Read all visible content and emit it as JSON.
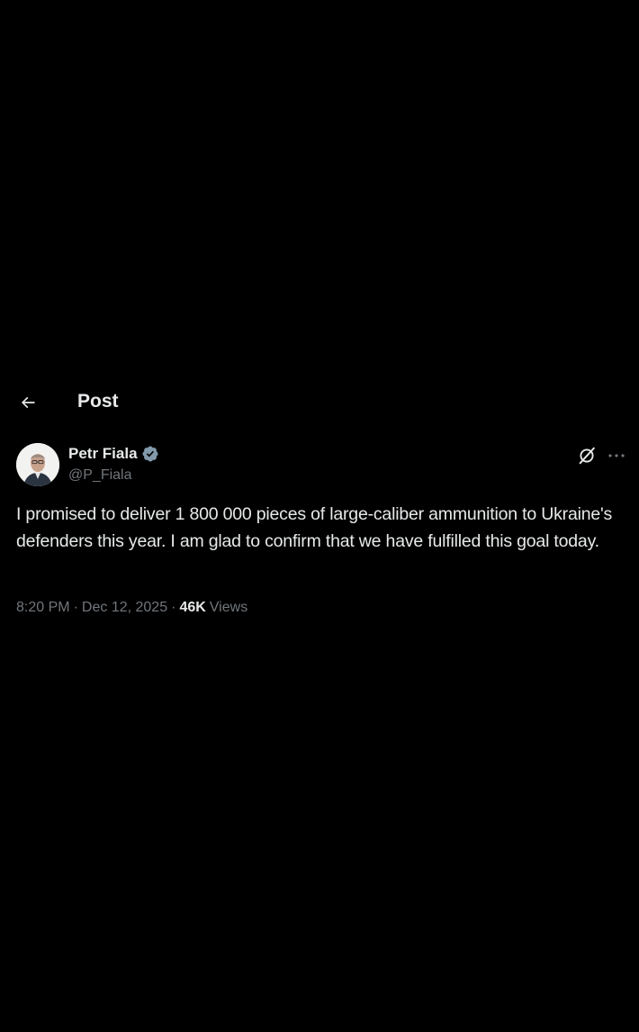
{
  "header": {
    "title": "Post",
    "back_icon": "arrow-left-icon"
  },
  "post": {
    "author_name": "Petr Fiala",
    "author_handle": "@P_Fiala",
    "verified_icon": "verified-badge-icon",
    "text": "I promised to deliver 1 800 000 pieces of large-caliber ammunition to Ukraine's defenders this year. I am glad to confirm that we have fulfilled this goal today.",
    "time": "8:20 PM",
    "date": "Dec 12, 2025",
    "separator": "·",
    "views_count": "46K",
    "views_label": "Views"
  },
  "icons": {
    "grok": "grok-icon",
    "more": "more-options-icon"
  },
  "colors": {
    "background": "#000000",
    "primary_text": "#e7e9ea",
    "secondary_text": "#71767b",
    "verified_badge": "#829aab"
  }
}
